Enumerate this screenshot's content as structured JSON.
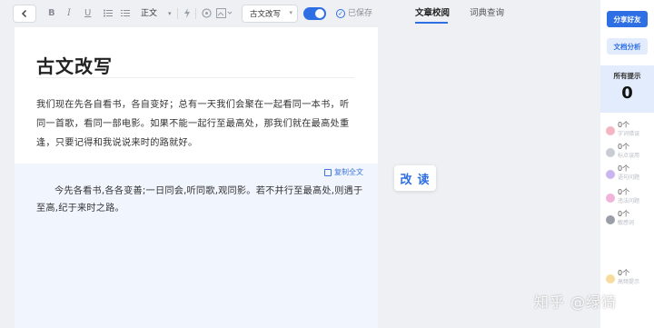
{
  "toolbar": {
    "format_select": "正文",
    "mode_select": "古文改写",
    "toggle_on": true,
    "saved_label": "已保存",
    "icons": [
      "back-icon",
      "bold-icon",
      "italic-icon",
      "underline-icon",
      "bullet-list-icon",
      "numbered-list-icon",
      "caret-down-icon",
      "lightning-icon",
      "palette-icon",
      "image-icon"
    ]
  },
  "tabs": [
    {
      "label": "文章校阅",
      "active": true
    },
    {
      "label": "词典查询",
      "active": false
    }
  ],
  "document": {
    "title": "古文改写",
    "body": "我们现在先各自看书，各自变好；总有一天我们会聚在一起看同一本书，听同一首歌，看同一部电影。如果不能一起行至最高处，那我们就在最高处重逢，只要记得和我说说来时的路就好。",
    "copy_label": "复制全文",
    "rewrite": "今先各看书,各各变善;一日同会,听同歌,观同影。若不并行至最高处,则遇于至高,纪于来时之路。"
  },
  "rewrite_button": "改读",
  "side_panel": {
    "share_label": "分享好友",
    "analysis_label": "文档分析",
    "summary_label": "所有提示",
    "summary_count": "0",
    "issues": [
      {
        "count": "0个",
        "label": "字词错误",
        "color": "#f5b6c4"
      },
      {
        "count": "0个",
        "label": "标点误用",
        "color": "#c8ccd3"
      },
      {
        "count": "0个",
        "label": "语句问题",
        "color": "#c9b5ef"
      },
      {
        "count": "0个",
        "label": "违法问题",
        "color": "#f0b3da"
      },
      {
        "count": "0个",
        "label": "敏感词",
        "color": "#9a9ea6"
      },
      {
        "count": "0个",
        "label": "高频提示",
        "color": "#f7dc9d"
      }
    ]
  },
  "watermark": "知乎 @绿猗"
}
